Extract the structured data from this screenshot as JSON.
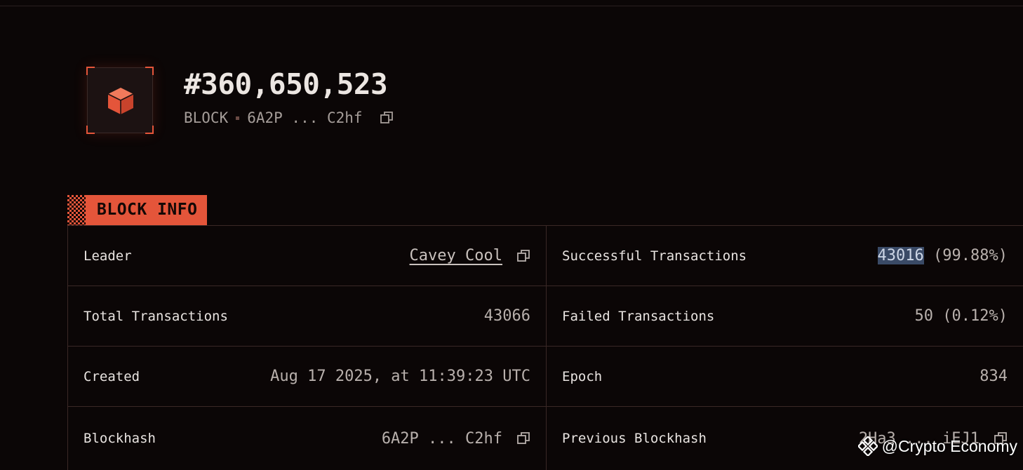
{
  "header": {
    "block_number": "#360,650,523",
    "type_label": "BLOCK",
    "hash_short": "6A2P ... C2hf"
  },
  "section": {
    "title": "BLOCK INFO"
  },
  "info": {
    "leader": {
      "label": "Leader",
      "value": "Cavey Cool"
    },
    "successful": {
      "label": "Successful Transactions",
      "count": "43016",
      "pct": " (99.88%)"
    },
    "total": {
      "label": "Total Transactions",
      "value": "43066"
    },
    "failed": {
      "label": "Failed Transactions",
      "value": "50 (0.12%)"
    },
    "created": {
      "label": "Created",
      "value": "Aug 17 2025, at 11:39:23 UTC"
    },
    "epoch": {
      "label": "Epoch",
      "value": "834"
    },
    "blockhash": {
      "label": "Blockhash",
      "value": "6A2P ... C2hf"
    },
    "prev_blockhash": {
      "label": "Previous Blockhash",
      "value": "2Ha3 ... iEJ1"
    }
  },
  "watermark": {
    "text": "@Crypto Economy"
  },
  "colors": {
    "accent": "#e4553a",
    "background": "#0b0606",
    "selection": "#3a4a66"
  },
  "icons": [
    "cube-icon",
    "copy-icon",
    "binance-icon"
  ]
}
